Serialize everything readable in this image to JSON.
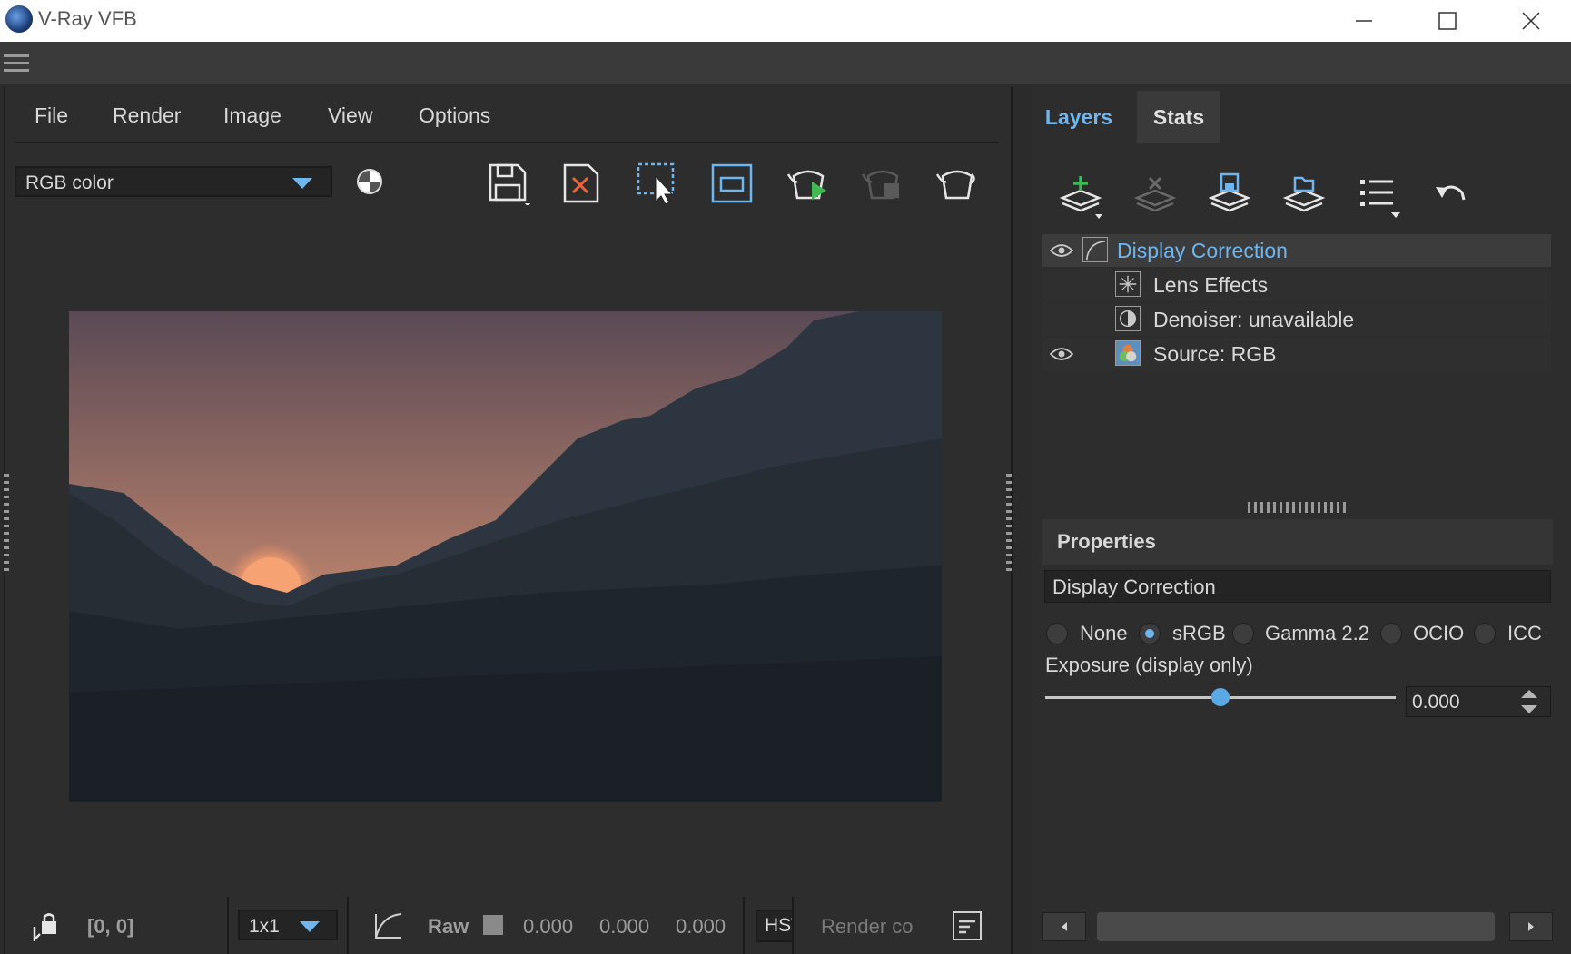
{
  "window": {
    "title": "V-Ray VFB",
    "minimize_icon": "minimize-icon",
    "maximize_icon": "maximize-icon",
    "close_icon": "close-icon"
  },
  "menu": {
    "items": [
      "File",
      "Render",
      "Image",
      "View",
      "Options"
    ]
  },
  "toolbar": {
    "channel_value": "RGB color",
    "icons": [
      "save-icon",
      "clear-image-icon",
      "region-render-icon",
      "follow-mouse-icon",
      "start-interactive-render-icon",
      "stop-render-icon",
      "render-icon"
    ]
  },
  "statusbar": {
    "coords": "[0, 0]",
    "sampling_value": "1x1",
    "mode_label": "Raw",
    "value_r": "0.000",
    "value_g": "0.000",
    "value_b": "0.000",
    "color_space_label": "HSV",
    "render_status": "Render co"
  },
  "layers_panel": {
    "tabs": [
      "Layers",
      "Stats"
    ],
    "active_tab": "Layers",
    "toolbar_icons": [
      "add-layer-icon",
      "delete-layer-icon",
      "save-layer-tree-icon",
      "load-layer-tree-icon",
      "layer-presets-icon",
      "undo-icon"
    ],
    "layers": [
      {
        "label": "Display Correction",
        "visible": true,
        "selected": true
      },
      {
        "label": "Lens Effects",
        "visible": false,
        "selected": false
      },
      {
        "label": "Denoiser: unavailable",
        "visible": false,
        "selected": false
      },
      {
        "label": "Source: RGB",
        "visible": true,
        "selected": false
      }
    ]
  },
  "properties": {
    "header": "Properties",
    "title": "Display Correction",
    "options": [
      "None",
      "sRGB",
      "Gamma 2.2",
      "OCIO",
      "ICC"
    ],
    "selected_option": "sRGB",
    "exposure_label": "Exposure (display only)",
    "exposure_value": "0.000",
    "exposure_slider_fraction": 0.5
  },
  "colors": {
    "accent": "#6fb5ee",
    "background": "#2d2d2d",
    "panel": "#3a3a3a"
  }
}
